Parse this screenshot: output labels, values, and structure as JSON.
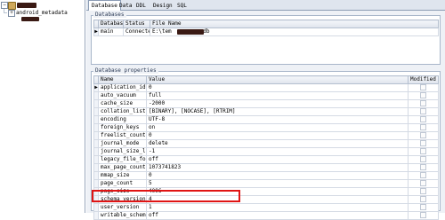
{
  "tree": {
    "root_label": "",
    "db_label": "android_metadata"
  },
  "tabs": [
    "Database",
    "Data",
    "DDL",
    "Design",
    "SQL"
  ],
  "databases": {
    "title": "Databases",
    "columns": [
      "Database",
      "Status",
      "File Name"
    ],
    "rows": [
      {
        "marker": "▶",
        "database": "main",
        "status": "Connected",
        "file": "E:\\tem",
        "file_suffix": ".db"
      }
    ]
  },
  "properties": {
    "title": "Database properties",
    "columns": [
      "Name",
      "Value",
      "Modified"
    ],
    "rows": [
      {
        "marker": "▶",
        "name": "application_id",
        "value": "0"
      },
      {
        "marker": "",
        "name": "auto_vacuum",
        "value": "full"
      },
      {
        "marker": "",
        "name": "cache_size",
        "value": "-2000"
      },
      {
        "marker": "",
        "name": "collation_list",
        "value": "[BINARY], [NOCASE], [RTRIM]"
      },
      {
        "marker": "",
        "name": "encoding",
        "value": "UTF-8"
      },
      {
        "marker": "",
        "name": "foreign_keys",
        "value": "on"
      },
      {
        "marker": "",
        "name": "freelist_count",
        "value": "0"
      },
      {
        "marker": "",
        "name": "journal_mode",
        "value": "delete"
      },
      {
        "marker": "",
        "name": "journal_size_limit",
        "value": "-1"
      },
      {
        "marker": "",
        "name": "legacy_file_format",
        "value": "off"
      },
      {
        "marker": "",
        "name": "max_page_count",
        "value": "1073741823"
      },
      {
        "marker": "",
        "name": "mmap_size",
        "value": "0"
      },
      {
        "marker": "",
        "name": "page_count",
        "value": "5"
      },
      {
        "marker": "",
        "name": "page_size",
        "value": "4096"
      },
      {
        "marker": "",
        "name": "schema_version",
        "value": "4"
      },
      {
        "marker": "",
        "name": "user_version",
        "value": "1"
      },
      {
        "marker": "",
        "name": "writable_schema",
        "value": "off"
      }
    ]
  },
  "colors": {
    "highlight": "#e01414",
    "redaction": "#3a1a14"
  }
}
